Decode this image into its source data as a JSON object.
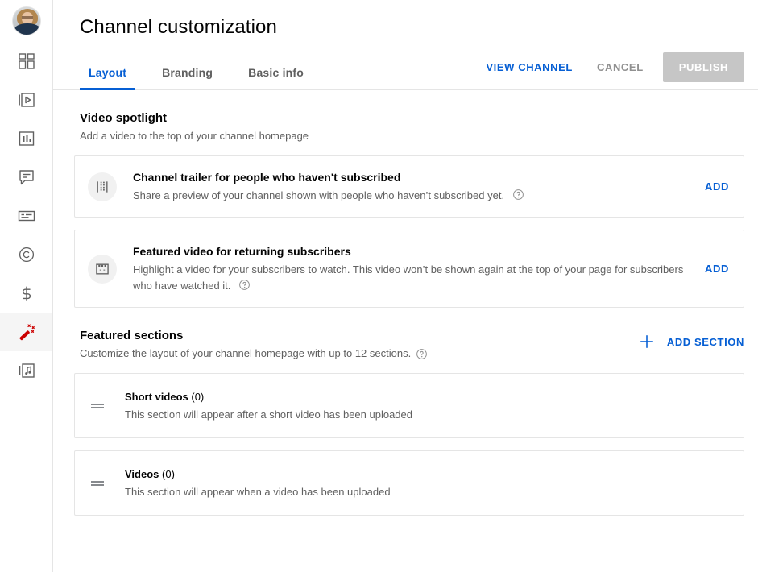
{
  "sidebar": {
    "avatar_label": "channel-avatar",
    "items": [
      {
        "icon": "dashboard-icon",
        "name": "dashboard",
        "active": false
      },
      {
        "icon": "content-video-icon",
        "name": "content",
        "active": false
      },
      {
        "icon": "analytics-bar-chart-icon",
        "name": "analytics",
        "active": false
      },
      {
        "icon": "comments-bubble-icon",
        "name": "comments",
        "active": false
      },
      {
        "icon": "subtitles-icon",
        "name": "subtitles",
        "active": false
      },
      {
        "icon": "copyright-icon",
        "name": "copyright",
        "active": false
      },
      {
        "icon": "monetization-dollar-icon",
        "name": "earn",
        "active": false
      },
      {
        "icon": "magic-wand-icon",
        "name": "customization",
        "active": true
      },
      {
        "icon": "audio-library-music-icon",
        "name": "audio-library",
        "active": false
      }
    ]
  },
  "header": {
    "title": "Channel customization",
    "tabs": [
      {
        "label": "Layout",
        "active": true
      },
      {
        "label": "Branding",
        "active": false
      },
      {
        "label": "Basic info",
        "active": false
      }
    ],
    "view_channel_label": "VIEW CHANNEL",
    "cancel_label": "CANCEL",
    "publish_label": "PUBLISH"
  },
  "video_spotlight": {
    "title": "Video spotlight",
    "subtitle": "Add a video to the top of your channel homepage",
    "cards": [
      {
        "icon": "film-strip-icon",
        "title": "Channel trailer for people who haven't subscribed",
        "description": "Share a preview of your channel shown with people who haven’t subscribed yet.",
        "action_label": "ADD",
        "has_help": true
      },
      {
        "icon": "featured-video-icon",
        "title": "Featured video for returning subscribers",
        "description": "Highlight a video for your subscribers to watch. This video won’t be shown again at the top of your page for subscribers who have watched it.",
        "action_label": "ADD",
        "has_help": true
      }
    ]
  },
  "featured_sections": {
    "title": "Featured sections",
    "subtitle": "Customize the layout of your channel homepage with up to 12 sections.",
    "add_section_label": "ADD SECTION",
    "rows": [
      {
        "title": "Short videos",
        "count": "(0)",
        "description": "This section will appear after a short video has been uploaded"
      },
      {
        "title": "Videos",
        "count": "(0)",
        "description": "This section will appear when a video has been uploaded"
      }
    ]
  },
  "colors": {
    "accent_blue": "#065fd4",
    "brand_red": "#cc0000",
    "text_primary": "#030303",
    "text_secondary": "#606060",
    "border": "#e5e5e5",
    "disabled_button": "#c6c6c6"
  }
}
